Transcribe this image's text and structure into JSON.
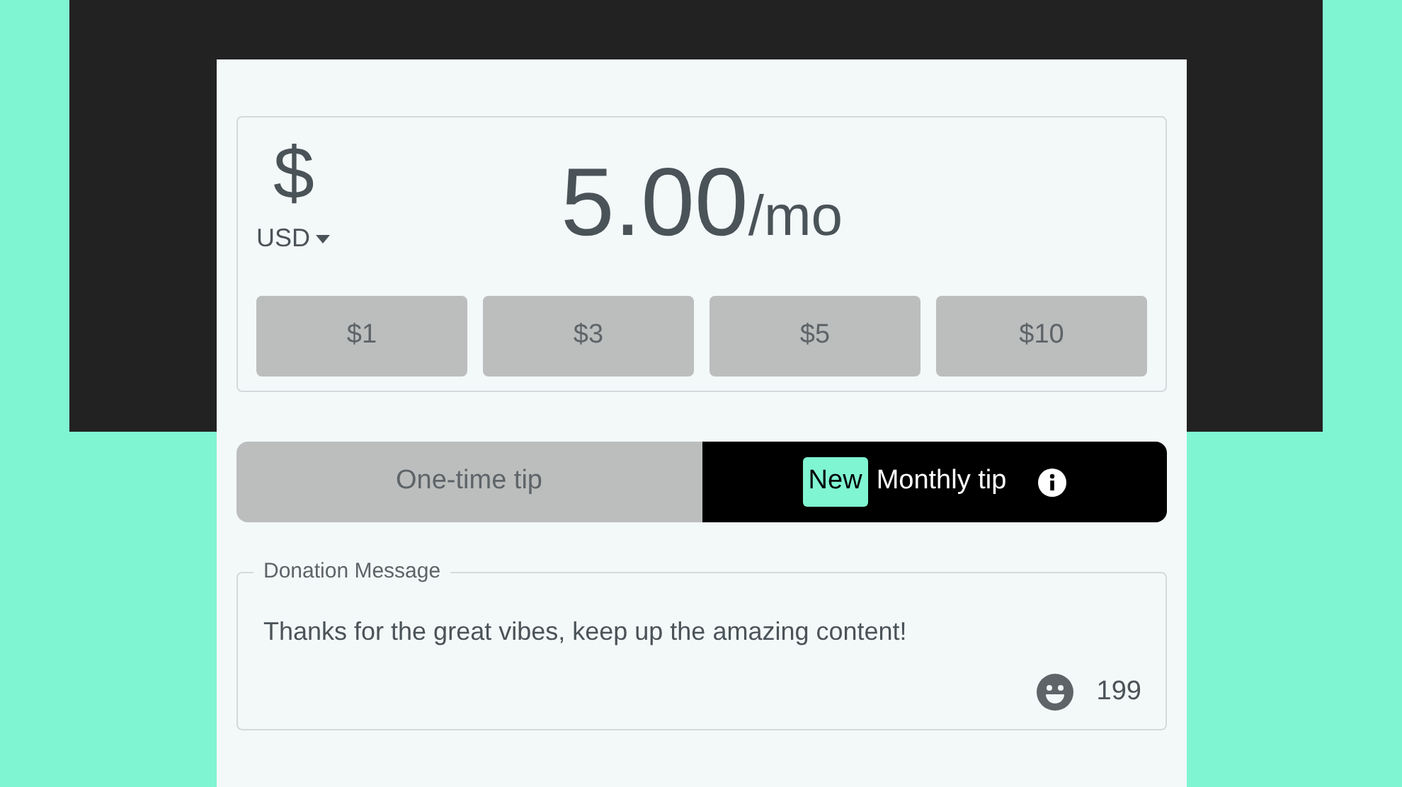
{
  "amount": {
    "symbol": "$",
    "currency": "USD",
    "value": "5.00",
    "period": "/mo"
  },
  "presets": [
    {
      "label": "$1"
    },
    {
      "label": "$3"
    },
    {
      "label": "$5"
    },
    {
      "label": "$10"
    }
  ],
  "tabs": [
    {
      "label": "One-time tip",
      "selected": false
    },
    {
      "label": "Monthly tip",
      "selected": true,
      "badge": "New",
      "info": true
    }
  ],
  "message": {
    "label": "Donation Message",
    "value": "Thanks for the great vibes, keep up the amazing content!",
    "counter": "199"
  }
}
